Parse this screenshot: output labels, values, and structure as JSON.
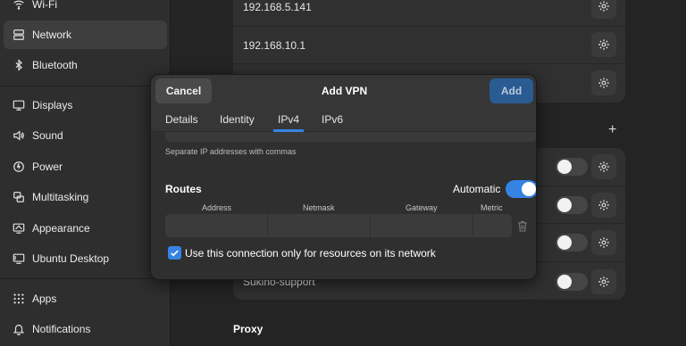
{
  "sidebar": {
    "items": [
      {
        "label": "Wi-Fi",
        "icon": "wifi-icon"
      },
      {
        "label": "Network",
        "icon": "network-icon",
        "active": true
      },
      {
        "label": "Bluetooth",
        "icon": "bluetooth-icon"
      },
      {
        "label": "Displays",
        "icon": "display-icon"
      },
      {
        "label": "Sound",
        "icon": "speaker-icon"
      },
      {
        "label": "Power",
        "icon": "power-icon"
      },
      {
        "label": "Multitasking",
        "icon": "multitasking-icon"
      },
      {
        "label": "Appearance",
        "icon": "appearance-icon"
      },
      {
        "label": "Ubuntu Desktop",
        "icon": "ubuntu-desktop-icon"
      },
      {
        "label": "Apps",
        "icon": "apps-grid-icon"
      },
      {
        "label": "Notifications",
        "icon": "bell-icon"
      }
    ]
  },
  "main": {
    "connections": [
      "192.168.5.141",
      "192.168.10.1"
    ],
    "vpn_last_item": "Sukino-support",
    "proxy_title": "Proxy"
  },
  "dialog": {
    "title": "Add VPN",
    "cancel_label": "Cancel",
    "add_label": "Add",
    "tabs": [
      "Details",
      "Identity",
      "IPv4",
      "IPv6"
    ],
    "active_tab": "IPv4",
    "dns_hint": "Separate IP addresses with commas",
    "routes_label": "Routes",
    "automatic_label": "Automatic",
    "automatic_on": true,
    "route_columns": [
      "Address",
      "Netmask",
      "Gateway",
      "Metric"
    ],
    "only_resources_label": "Use this connection only for resources on its network",
    "only_resources_checked": true
  },
  "colors": {
    "accent": "#3584e4",
    "add_button": "#2a5b92",
    "sidebar_bg": "#2e2e2e",
    "window_bg": "#242424",
    "dialog_bg": "#363636"
  }
}
